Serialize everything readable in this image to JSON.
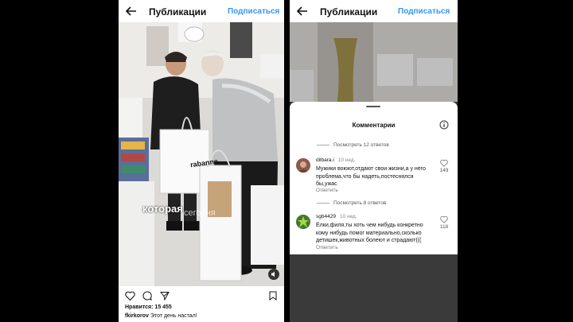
{
  "left": {
    "header": {
      "title": "Публикации",
      "subscribe": "Подписаться"
    },
    "photo": {
      "brand": "rabanne",
      "caption_main": "которая",
      "caption_faded": "сегодня"
    },
    "likes": "Нравится: 15 455",
    "caption": {
      "user": "fkirkorov",
      "text": "Этот день настал!"
    }
  },
  "right": {
    "header": {
      "title": "Публикации",
      "subscribe": "Подписаться"
    },
    "comments": {
      "title": "Комментарии",
      "view_replies_1": "Посмотреть 12 ответов",
      "items": [
        {
          "user": "dilbara.i",
          "time": "10 нед.",
          "text": "Мужики воюют,отдают свои жизни,а у него проблема,что бы надеть,постеснялся бы,ужас",
          "reply": "Ответить",
          "likes": "149"
        },
        {
          "user": "sgb4429",
          "time": "10 нед.",
          "text": "Ёлки,филя,ты хоть чем нибудь конкретно кому нибудь помог материально,сколько детишек,животных болеют и страдают(((",
          "reply": "Ответить",
          "likes": "118"
        }
      ],
      "view_replies_2": "Посмотреть 8 ответов"
    }
  },
  "colors": {
    "link": "#3897f0",
    "background": "#000000",
    "overlay": "#3a3a3a"
  },
  "icons": [
    "back-arrow-icon",
    "heart-icon",
    "comment-icon",
    "share-icon",
    "bookmark-icon",
    "info-icon",
    "volume-icon"
  ]
}
